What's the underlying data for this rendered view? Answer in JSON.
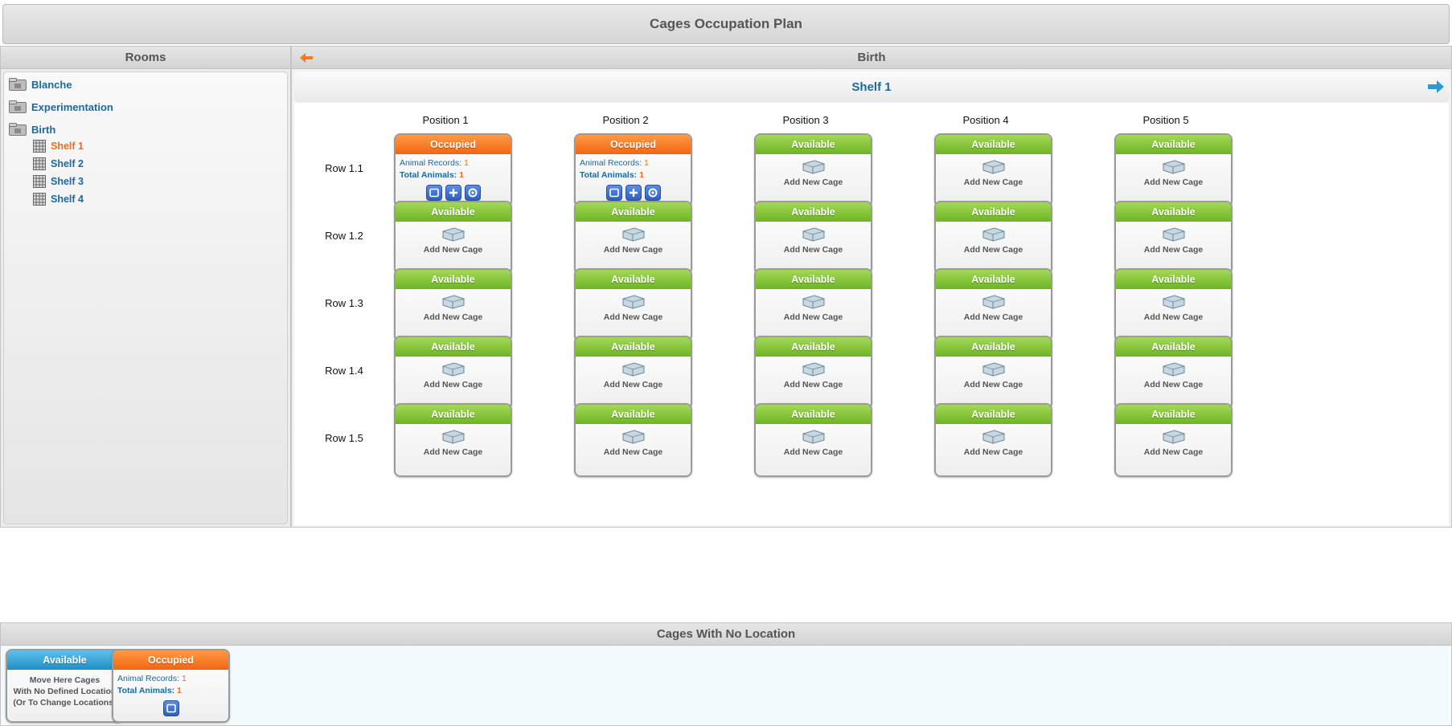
{
  "header": {
    "title": "Cages Occupation Plan"
  },
  "rooms_panel": {
    "title": "Rooms",
    "rooms": [
      {
        "label": "Blanche"
      },
      {
        "label": "Experimentation"
      },
      {
        "label": "Birth"
      }
    ],
    "shelves": [
      {
        "label": "Shelf 1",
        "active": true
      },
      {
        "label": "Shelf 2"
      },
      {
        "label": "Shelf 3"
      },
      {
        "label": "Shelf 4"
      }
    ]
  },
  "main": {
    "room_title": "Birth",
    "shelf_title": "Shelf 1",
    "positions": [
      "Position 1",
      "Position 2",
      "Position 3",
      "Position 4",
      "Position 5"
    ],
    "rows": [
      "Row 1.1",
      "Row 1.2",
      "Row 1.3",
      "Row 1.4",
      "Row 1.5"
    ],
    "status_available": "Available",
    "status_occupied": "Occupied",
    "add_cage_label": "Add New Cage",
    "animal_records_label": "Animal Records:",
    "total_animals_label": "Total Animals:",
    "occupied_cells": [
      {
        "row": 0,
        "col": 0,
        "animal_records": "1",
        "total_animals": "1"
      },
      {
        "row": 0,
        "col": 1,
        "animal_records": "1",
        "total_animals": "1"
      }
    ]
  },
  "no_location": {
    "title": "Cages With No Location",
    "available_label": "Available",
    "move_text_1": "Move Here Cages",
    "move_text_2": "With No Defined Location",
    "move_text_3": "(Or To Change Locations)",
    "occupied_label": "Occupied",
    "animal_records_label": "Animal Records:",
    "animal_records": "1",
    "total_animals_label": "Total Animals:",
    "total_animals": "1"
  },
  "colors": {
    "available": "#7dc13a",
    "occupied": "#f57a24",
    "blue": "#2b9bd3",
    "link": "#1a6a9a",
    "active": "#f26d1d"
  }
}
